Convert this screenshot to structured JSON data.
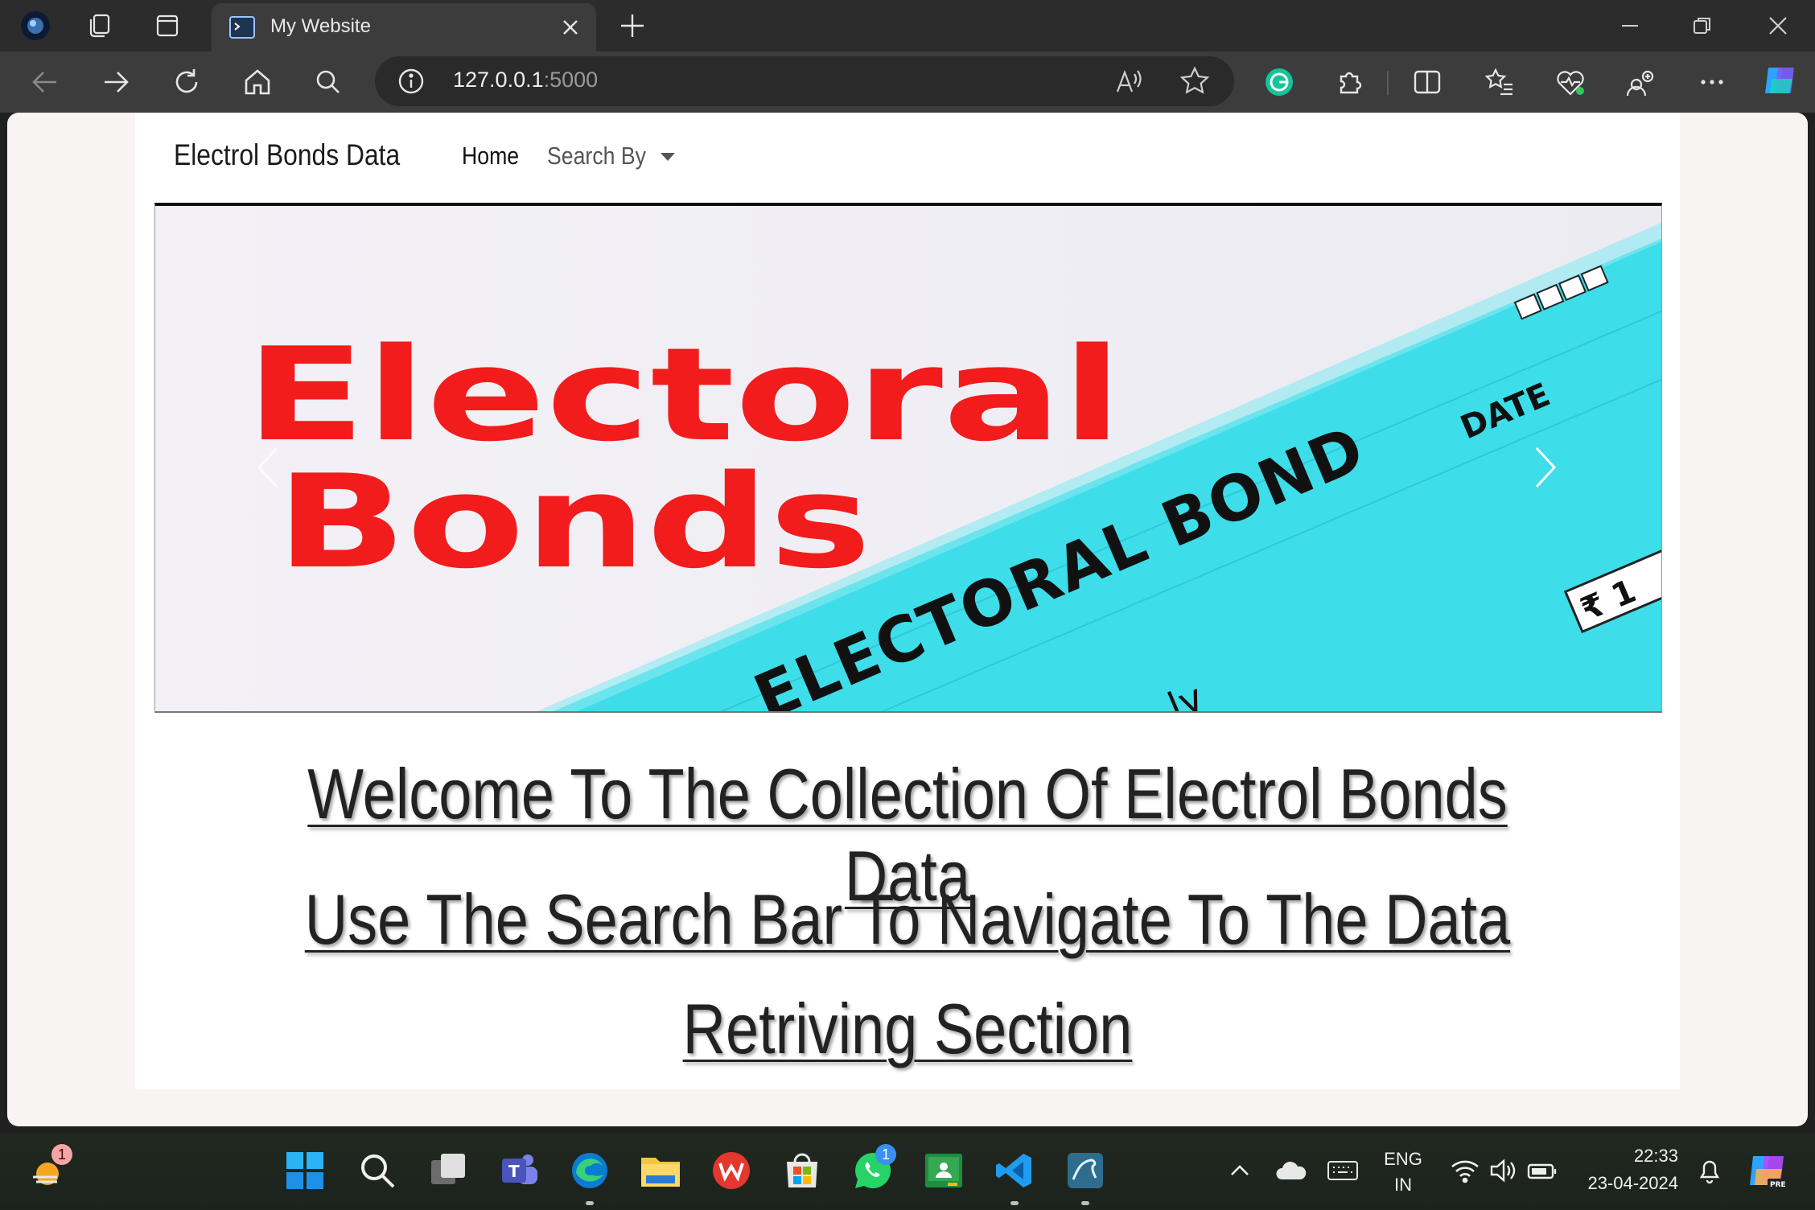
{
  "browser": {
    "tab_title": "My Website",
    "url_host": "127.0.0.1",
    "url_port": ":5000"
  },
  "site": {
    "brand": "Electrol Bonds Data",
    "nav_home": "Home",
    "nav_search": "Search By",
    "banner": {
      "line1": "Electoral",
      "line2": "Bonds",
      "stripe_text": "ELECTORAL BOND",
      "date_label": "DATE",
      "rupee_text": "₹ 1",
      "partial_text": "ly"
    },
    "heading1": "Welcome To The Collection Of Electrol Bonds Data",
    "heading2_line1": "Use The Search Bar To Navigate To The Data",
    "heading2_line2": "Retriving Section"
  },
  "taskbar": {
    "weather_badge": "1",
    "whatsapp_badge": "1",
    "lang_line1": "ENG",
    "lang_line2": "IN",
    "time": "22:33",
    "date": "23-04-2024"
  },
  "colors": {
    "banner_red": "#f21c1c",
    "banner_cyan": "#3ddde9",
    "accent_blue": "#0a84ff"
  }
}
